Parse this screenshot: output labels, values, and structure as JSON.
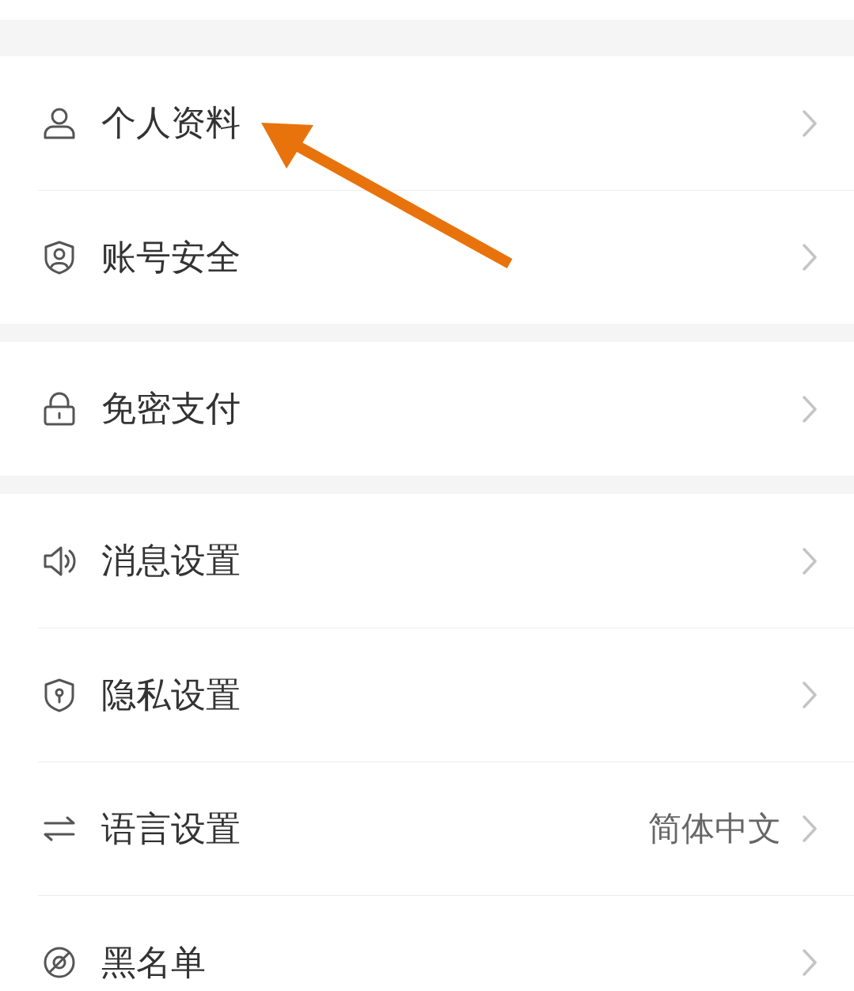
{
  "groups": [
    {
      "items": [
        {
          "label": "个人资料"
        },
        {
          "label": "账号安全"
        }
      ]
    },
    {
      "items": [
        {
          "label": "免密支付"
        }
      ]
    },
    {
      "items": [
        {
          "label": "消息设置"
        },
        {
          "label": "隐私设置"
        },
        {
          "label": "语言设置",
          "value": "简体中文"
        },
        {
          "label": "黑名单"
        }
      ]
    }
  ],
  "annotation": {
    "kind": "arrow"
  }
}
